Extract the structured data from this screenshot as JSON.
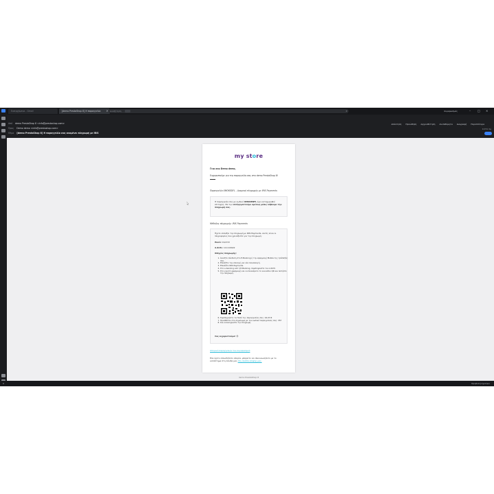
{
  "tabs": {
    "inbox_label": "Εισερχόμενα - Gmail",
    "message_label": "[demo PrestaShop 8] Η παραγγελία",
    "close_glyph": "×"
  },
  "search": {
    "placeholder": "Αναζήτηση",
    "shortcut": "Ctrl+K"
  },
  "account": "Λογαριασμός",
  "window_controls": [
    "–",
    "□",
    "×"
  ],
  "header": {
    "from_label": "Από",
    "from_value": "demo PrestaShop 8 <info@prestashop.com>",
    "to_label": "Προς",
    "to_value": "Demo demo <info@prestashop.com>",
    "subject_label": "Θέμα",
    "subject_value": "[demo PrestaShop 8] Η παραγγελία σας αναμένει πληρωμή με IRIS",
    "date": "10:51 πμ",
    "toolbar": [
      "Απάντηση",
      "Προώθηση",
      "Αρχειοθέτηση",
      "Ανεπιθύμητα",
      "Διαγραφή",
      "Περισσότερα"
    ]
  },
  "email": {
    "logo_a": "my st",
    "logo_o": "o",
    "logo_b": "re",
    "greeting": "Γεια σου Demo demo,",
    "thanks": "Ευχαριστούμε για την παραγγελία σας στο demo PrestaShop 8!",
    "order_line": "Παραγγελία XMOKEDFL - Αναμονή πληρωμής με IRIS Payments",
    "box1": {
      "t1": "Η παραγγελία σας με κωδικό ",
      "ref": "XMOKEDFL",
      "t2": " έχει καταχωρηθεί επιτυχώς. Θα την ",
      "strong": "επεξεργαστούμε αμέσως μόλις λάβουμε την πληρωμή σας."
    },
    "method_title": "Μέθοδος πληρωμής: IRIS Payments",
    "box2": {
      "intro": "Έχετε επιλέξει την πληρωμή με IRIS Payments. Αυτές είναι οι πληροφορίες που χρειάζεστε για την πληρωμή:",
      "amount_label": "Ποσό:",
      "amount_value": "16,03 €",
      "afm_label": "Α.Φ.Μ.:",
      "afm_value": "111119922",
      "steps_title": "Οδηγίες πληρωμής:",
      "steps": [
        "Άνοιξτε σύνδεση στο E-Banking ή την εφαρμογή Mobile της τράπεζάς σας.",
        "Επιλέξτε την επιλογή για νέα συναλλαγή.",
        "Επιλέξτε IRIS Payments.",
        "Στο e-banking κλπ ή E-Banking, συμπληρώστε τον Α.Φ.Μ.",
        "Στο κινητό εφαρμογή και να σκανάρετε το εικονίδιο QR και πατήστε την πληρωμή."
      ],
      "steps_after": [
        "Συμπληρώστε το Ποσό της παραγγελίας σας: 16,03 €",
        "Προσθέστε στο σημείωμα με τον κωδικό παραγγελίας σας: 357",
        "Και ολοκληρώστε την πληρωμή."
      ],
      "closing": "Σας ευχαριστούμε! 😍"
    },
    "history_link": "Ιστορικό παραγγελιών του λογαριασμού",
    "contact_t1": "Εάν έχετε οποιαδήποτε απορία, μπορείτε να επικοινωνήσετε με το κατάστημα στη σελίδα μας ",
    "contact_link": "στη σελίδα επαφής μας.",
    "footer": "demo PrestaShop 8"
  },
  "status": {
    "left": "0",
    "right": "Προβολή σχολίων"
  },
  "colors": {
    "accent": "#25b9d7",
    "brand": "#5a2d82",
    "dark": "#1e1f22"
  }
}
